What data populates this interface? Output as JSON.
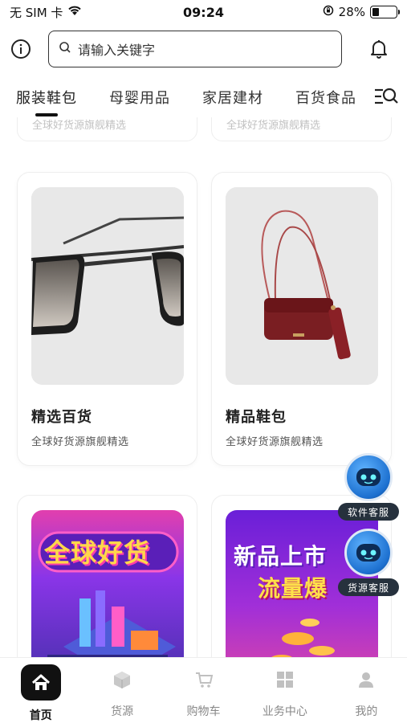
{
  "status_bar": {
    "carrier": "无 SIM 卡",
    "time": "09:24",
    "battery_percent": "28%",
    "battery_level": 0.28
  },
  "header": {
    "search_placeholder": "请输入关键字"
  },
  "tabs": [
    {
      "label": "服装鞋包",
      "active": true
    },
    {
      "label": "母婴用品",
      "active": false
    },
    {
      "label": "家居建材",
      "active": false
    },
    {
      "label": "百货食品",
      "active": false
    }
  ],
  "partial_cards": [
    {
      "subtitle": "全球好货源旗舰精选"
    },
    {
      "subtitle": "全球好货源旗舰精选"
    }
  ],
  "cards": [
    {
      "title": "精选百货",
      "subtitle": "全球好货源旗舰精选",
      "image": "sunglasses"
    },
    {
      "title": "精品鞋包",
      "subtitle": "全球好货源旗舰精选",
      "image": "red-crossbody-bag"
    }
  ],
  "promos": [
    {
      "text": "全球好货",
      "image": "isometric-city-purple"
    },
    {
      "text_line1": "新品上市",
      "text_line2": "流量爆",
      "image": "isometric-coins-purple"
    }
  ],
  "bots": [
    {
      "label": "软件客服"
    },
    {
      "label": "货源客服"
    }
  ],
  "bottom_nav": [
    {
      "label": "首页",
      "icon": "home-icon",
      "active": true
    },
    {
      "label": "货源",
      "icon": "box-icon",
      "active": false
    },
    {
      "label": "购物车",
      "icon": "cart-icon",
      "active": false
    },
    {
      "label": "业务中心",
      "icon": "grid-icon",
      "active": false
    },
    {
      "label": "我的",
      "icon": "user-icon",
      "active": false
    }
  ],
  "colors": {
    "accent": "#111111",
    "promo_purple": "#7b2ff7",
    "promo_pink": "#e83fae"
  }
}
